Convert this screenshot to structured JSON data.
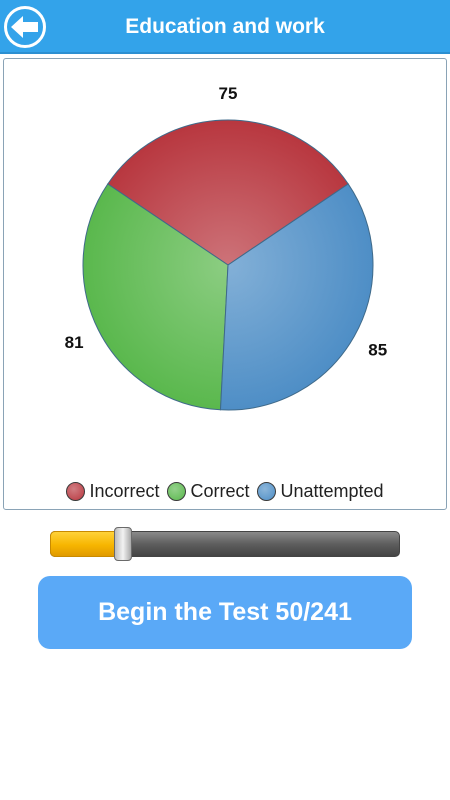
{
  "header": {
    "title": "Education and work",
    "back_icon": "back-arrow-icon"
  },
  "chart_data": {
    "type": "pie",
    "categories": [
      "Incorrect",
      "Correct",
      "Unattempted"
    ],
    "values": [
      75,
      81,
      85
    ],
    "colors": [
      "#b8373f",
      "#5ab84d",
      "#4e8ec6"
    ],
    "legend_position": "bottom"
  },
  "slider": {
    "value": 50,
    "max": 241
  },
  "begin_button": {
    "label": "Begin the Test 50/241"
  },
  "colors": {
    "header": "#33a3ea",
    "button": "#5aa9f7",
    "slider_fill": "#f7b500"
  }
}
